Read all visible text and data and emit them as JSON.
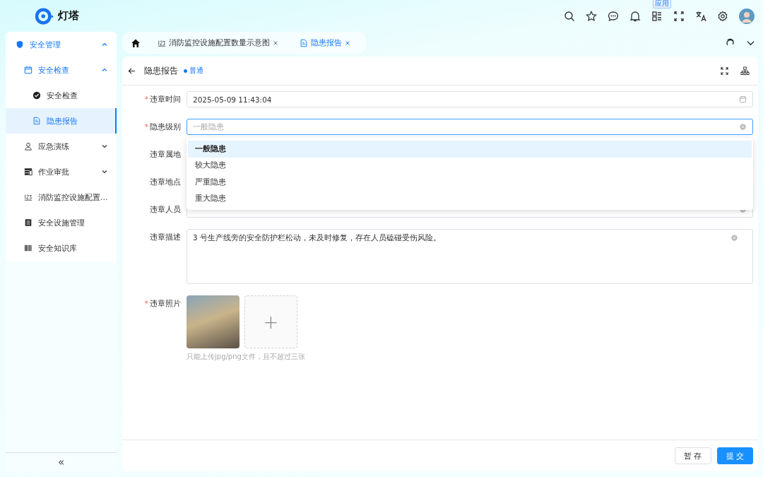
{
  "brand": {
    "name": "灯塔"
  },
  "header_icons": [
    {
      "kind": "search"
    },
    {
      "kind": "star"
    },
    {
      "kind": "chat"
    },
    {
      "kind": "bell"
    },
    {
      "kind": "apps",
      "badge": "应用"
    },
    {
      "kind": "fullscreen"
    },
    {
      "kind": "translate"
    },
    {
      "kind": "settings"
    },
    {
      "kind": "avatar"
    }
  ],
  "sidebar": {
    "items": [
      {
        "label": "安全管理",
        "kind": "shield",
        "expanded": true,
        "selected": false,
        "children": [
          {
            "label": "安全检查",
            "kind": "calendar",
            "expanded": true,
            "selected": false,
            "children": [
              {
                "label": "安全检查",
                "kind": "check",
                "selected": false
              },
              {
                "label": "隐患报告",
                "kind": "doc",
                "selected": true
              }
            ]
          },
          {
            "label": "应急演练",
            "kind": "user",
            "expanded": false,
            "selected": false
          },
          {
            "label": "作业审批",
            "kind": "layout",
            "expanded": false,
            "selected": false
          },
          {
            "label": "消防监控设施配置...",
            "kind": "numbers",
            "selected": false
          },
          {
            "label": "安全设施管理",
            "kind": "list",
            "selected": false
          },
          {
            "label": "安全知识库",
            "kind": "barcode",
            "selected": false
          }
        ]
      }
    ],
    "collapse": "«"
  },
  "tabs": [
    {
      "label": "消防监控设施配置数量示意图",
      "kind": "numbers",
      "selected": false
    },
    {
      "label": "隐患报告",
      "kind": "doc",
      "selected": true
    }
  ],
  "page": {
    "title": "隐患报告",
    "tag": "普通"
  },
  "form": {
    "fields": [
      {
        "kind": "date",
        "label": "违章时间",
        "required_mark": "*",
        "value": "2025-05-09 11:43:04"
      },
      {
        "kind": "select",
        "label": "隐患级别",
        "required_mark": "*",
        "placeholder": "一般隐患",
        "focused": true
      },
      {
        "kind": "text",
        "label": "违章属地"
      },
      {
        "kind": "text",
        "label": "违章地点"
      },
      {
        "kind": "select",
        "label": "违章人员"
      },
      {
        "kind": "textarea",
        "label": "违章描述",
        "value": "3 号生产线旁的安全防护栏松动，未及时修复，存在人员磕碰受伤风险。"
      },
      {
        "kind": "upload",
        "label": "违章照片",
        "required_mark": "*",
        "hint": "只能上传jpg/png文件，且不超过三张",
        "plus": "+"
      }
    ]
  },
  "dropdown": {
    "options": [
      {
        "label": "一般隐患",
        "selected": true
      },
      {
        "label": "较大隐患",
        "selected": false
      },
      {
        "label": "严重隐患",
        "selected": false
      },
      {
        "label": "重大隐患",
        "selected": false
      }
    ]
  },
  "buttons": [
    {
      "label": "暂 存",
      "kind": "default"
    },
    {
      "label": "提 交",
      "kind": "primary"
    }
  ]
}
